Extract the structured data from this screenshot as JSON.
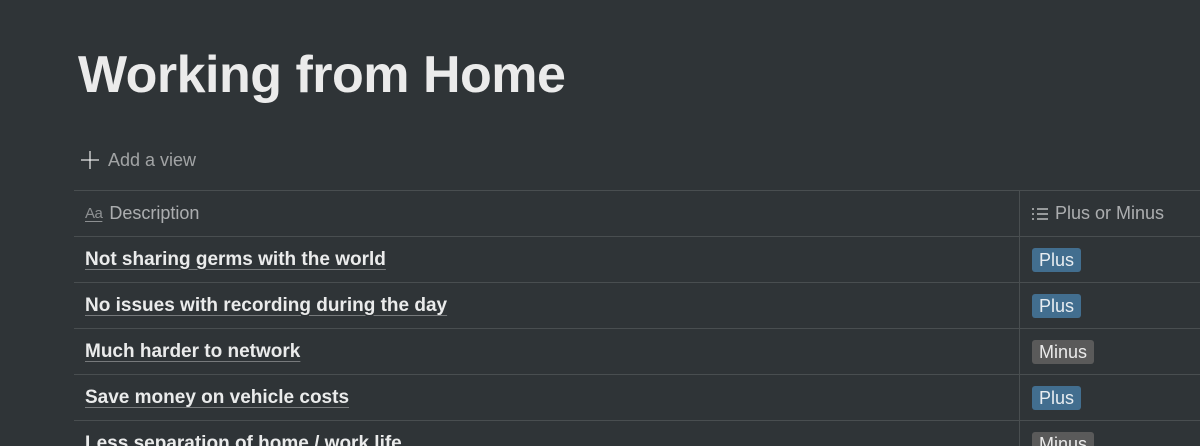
{
  "page": {
    "title": "Working from Home"
  },
  "add_view": {
    "label": "Add a view",
    "icon": "plus-icon"
  },
  "table": {
    "columns": [
      {
        "label": "Description",
        "icon": "text-property-icon"
      },
      {
        "label": "Plus or Minus",
        "icon": "list-property-icon"
      }
    ],
    "rows": [
      {
        "description": "Not sharing germs with the world",
        "tag": "Plus"
      },
      {
        "description": "No issues with recording during the day",
        "tag": "Plus"
      },
      {
        "description": "Much harder to network",
        "tag": "Minus"
      },
      {
        "description": "Save money on vehicle costs",
        "tag": "Plus"
      },
      {
        "description": "Less separation of home / work life",
        "tag": "Minus"
      }
    ]
  },
  "colors": {
    "background": "#2f3437",
    "plus_tag": "#426e8f",
    "minus_tag": "#5a5a5a"
  }
}
